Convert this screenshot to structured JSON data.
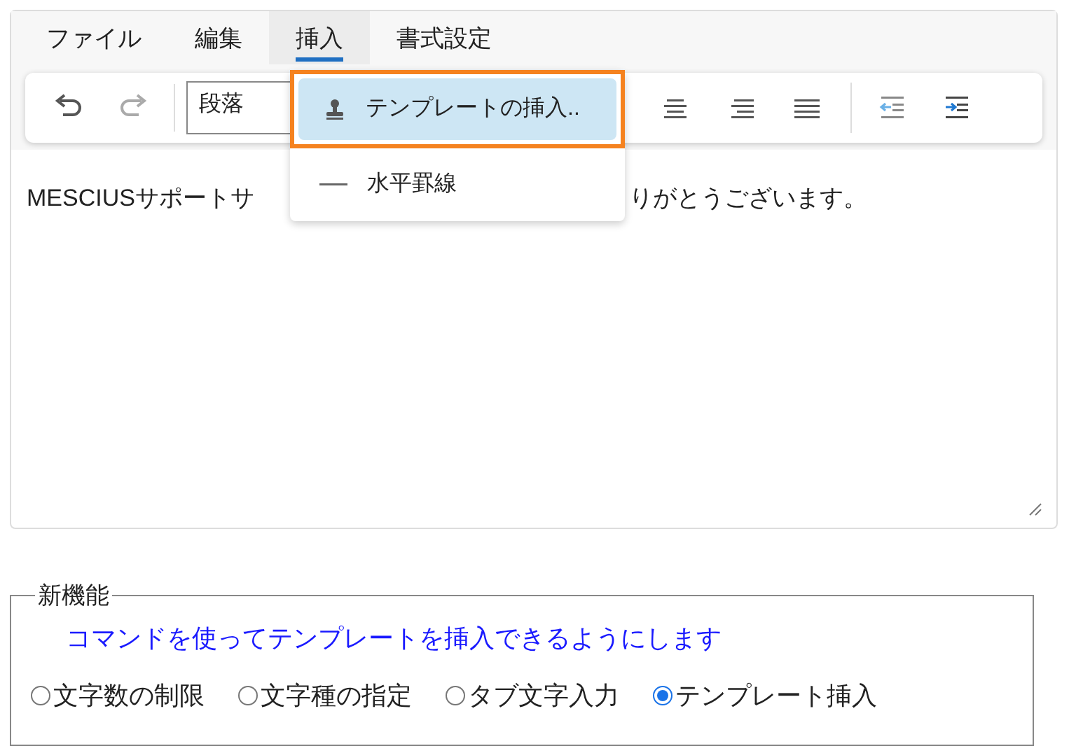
{
  "menu_tabs": [
    {
      "label": "ファイル",
      "selected": false
    },
    {
      "label": "編集",
      "selected": false
    },
    {
      "label": "挿入",
      "selected": true
    },
    {
      "label": "書式設定",
      "selected": false
    }
  ],
  "toolbar": {
    "paragraph_select": {
      "value": "段落"
    }
  },
  "dropdown": {
    "items": [
      {
        "label": "テンプレートの挿入..",
        "selected": true,
        "kind": "stamp"
      },
      {
        "label": "水平罫線",
        "selected": false,
        "kind": "rule"
      }
    ]
  },
  "editor": {
    "text_before": "MESCIUSサポートサ",
    "text_after": "りがとうございます。"
  },
  "feature_group": {
    "legend": "新機能",
    "description": "コマンドを使ってテンプレートを挿入できるようにします",
    "options": [
      {
        "label": "文字数の制限",
        "selected": false
      },
      {
        "label": "文字種の指定",
        "selected": false
      },
      {
        "label": "タブ文字入力",
        "selected": false
      },
      {
        "label": "テンプレート挿入",
        "selected": true
      }
    ]
  }
}
